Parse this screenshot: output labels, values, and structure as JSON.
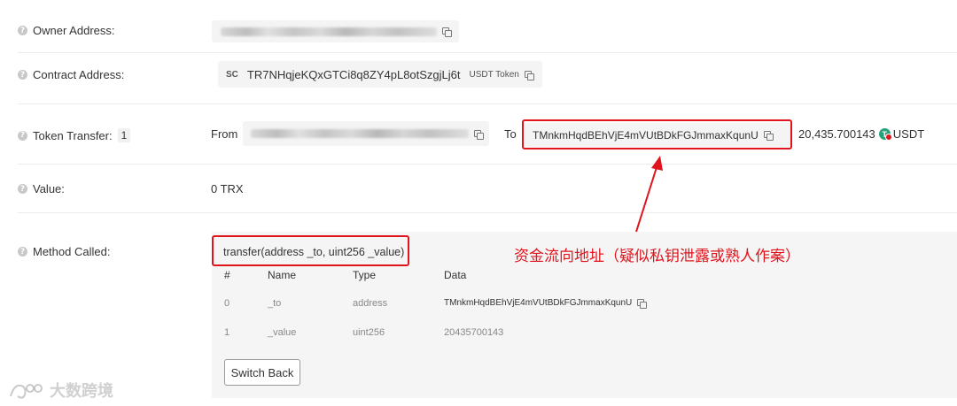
{
  "owner": {
    "label": "Owner Address:"
  },
  "contract": {
    "label": "Contract Address:",
    "type_badge": "SC",
    "address": "TR7NHqjeKQxGTCi8q8ZY4pL8otSzgjLj6t",
    "token_tag": "USDT Token"
  },
  "transfer": {
    "label": "Token Transfer:",
    "count": "1",
    "from_label": "From",
    "to_label": "To",
    "to_address": "TMnkmHqdBEhVjE4mVUtBDkFGJmmaxKqunU",
    "amount": "20,435.700143",
    "token": "USDT"
  },
  "value": {
    "label": "Value:",
    "amount": "0 TRX"
  },
  "method": {
    "label": "Method Called:",
    "signature": "transfer(address _to, uint256 _value)",
    "columns": [
      "#",
      "Name",
      "Type",
      "Data"
    ],
    "rows": [
      {
        "index": "0",
        "name": "_to",
        "type": "address",
        "data": "TMnkmHqdBEhVjE4mVUtBDkFGJmmaxKqunU"
      },
      {
        "index": "1",
        "name": "_value",
        "type": "uint256",
        "data": "20435700143"
      }
    ],
    "switch_button": "Switch Back"
  },
  "annotation": {
    "text": "资金流向地址（疑似私钥泄露或熟人作案）"
  },
  "watermark": {
    "text": "大数跨境"
  },
  "colors": {
    "highlight": "#e0141d",
    "tether": "#26a17b"
  }
}
